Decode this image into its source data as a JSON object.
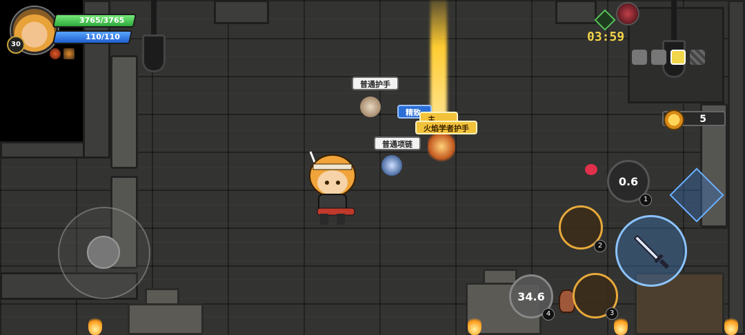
{
  "hud": {
    "player_level": "30",
    "hp_text": "3765/3765",
    "mp_text": "110/110",
    "timer": "03:59",
    "coin_count": "5"
  },
  "loot_labels": {
    "common_gloves": "普通护手",
    "fine_item": "精致",
    "main_item": "主",
    "fire_gloves": "火焰学者护手",
    "common_necklace": "普通项链"
  },
  "skills": {
    "skill1_cooldown": "0.6",
    "skill1_index": "1",
    "skill2_index": "2",
    "skill3_index": "3",
    "skill4_cooldown": "34.6",
    "skill4_index": "4"
  },
  "colors": {
    "hp": "#2faa3c",
    "mp": "#1f5fce",
    "gold": "#f2c33a",
    "timer": "#f3d44a"
  }
}
